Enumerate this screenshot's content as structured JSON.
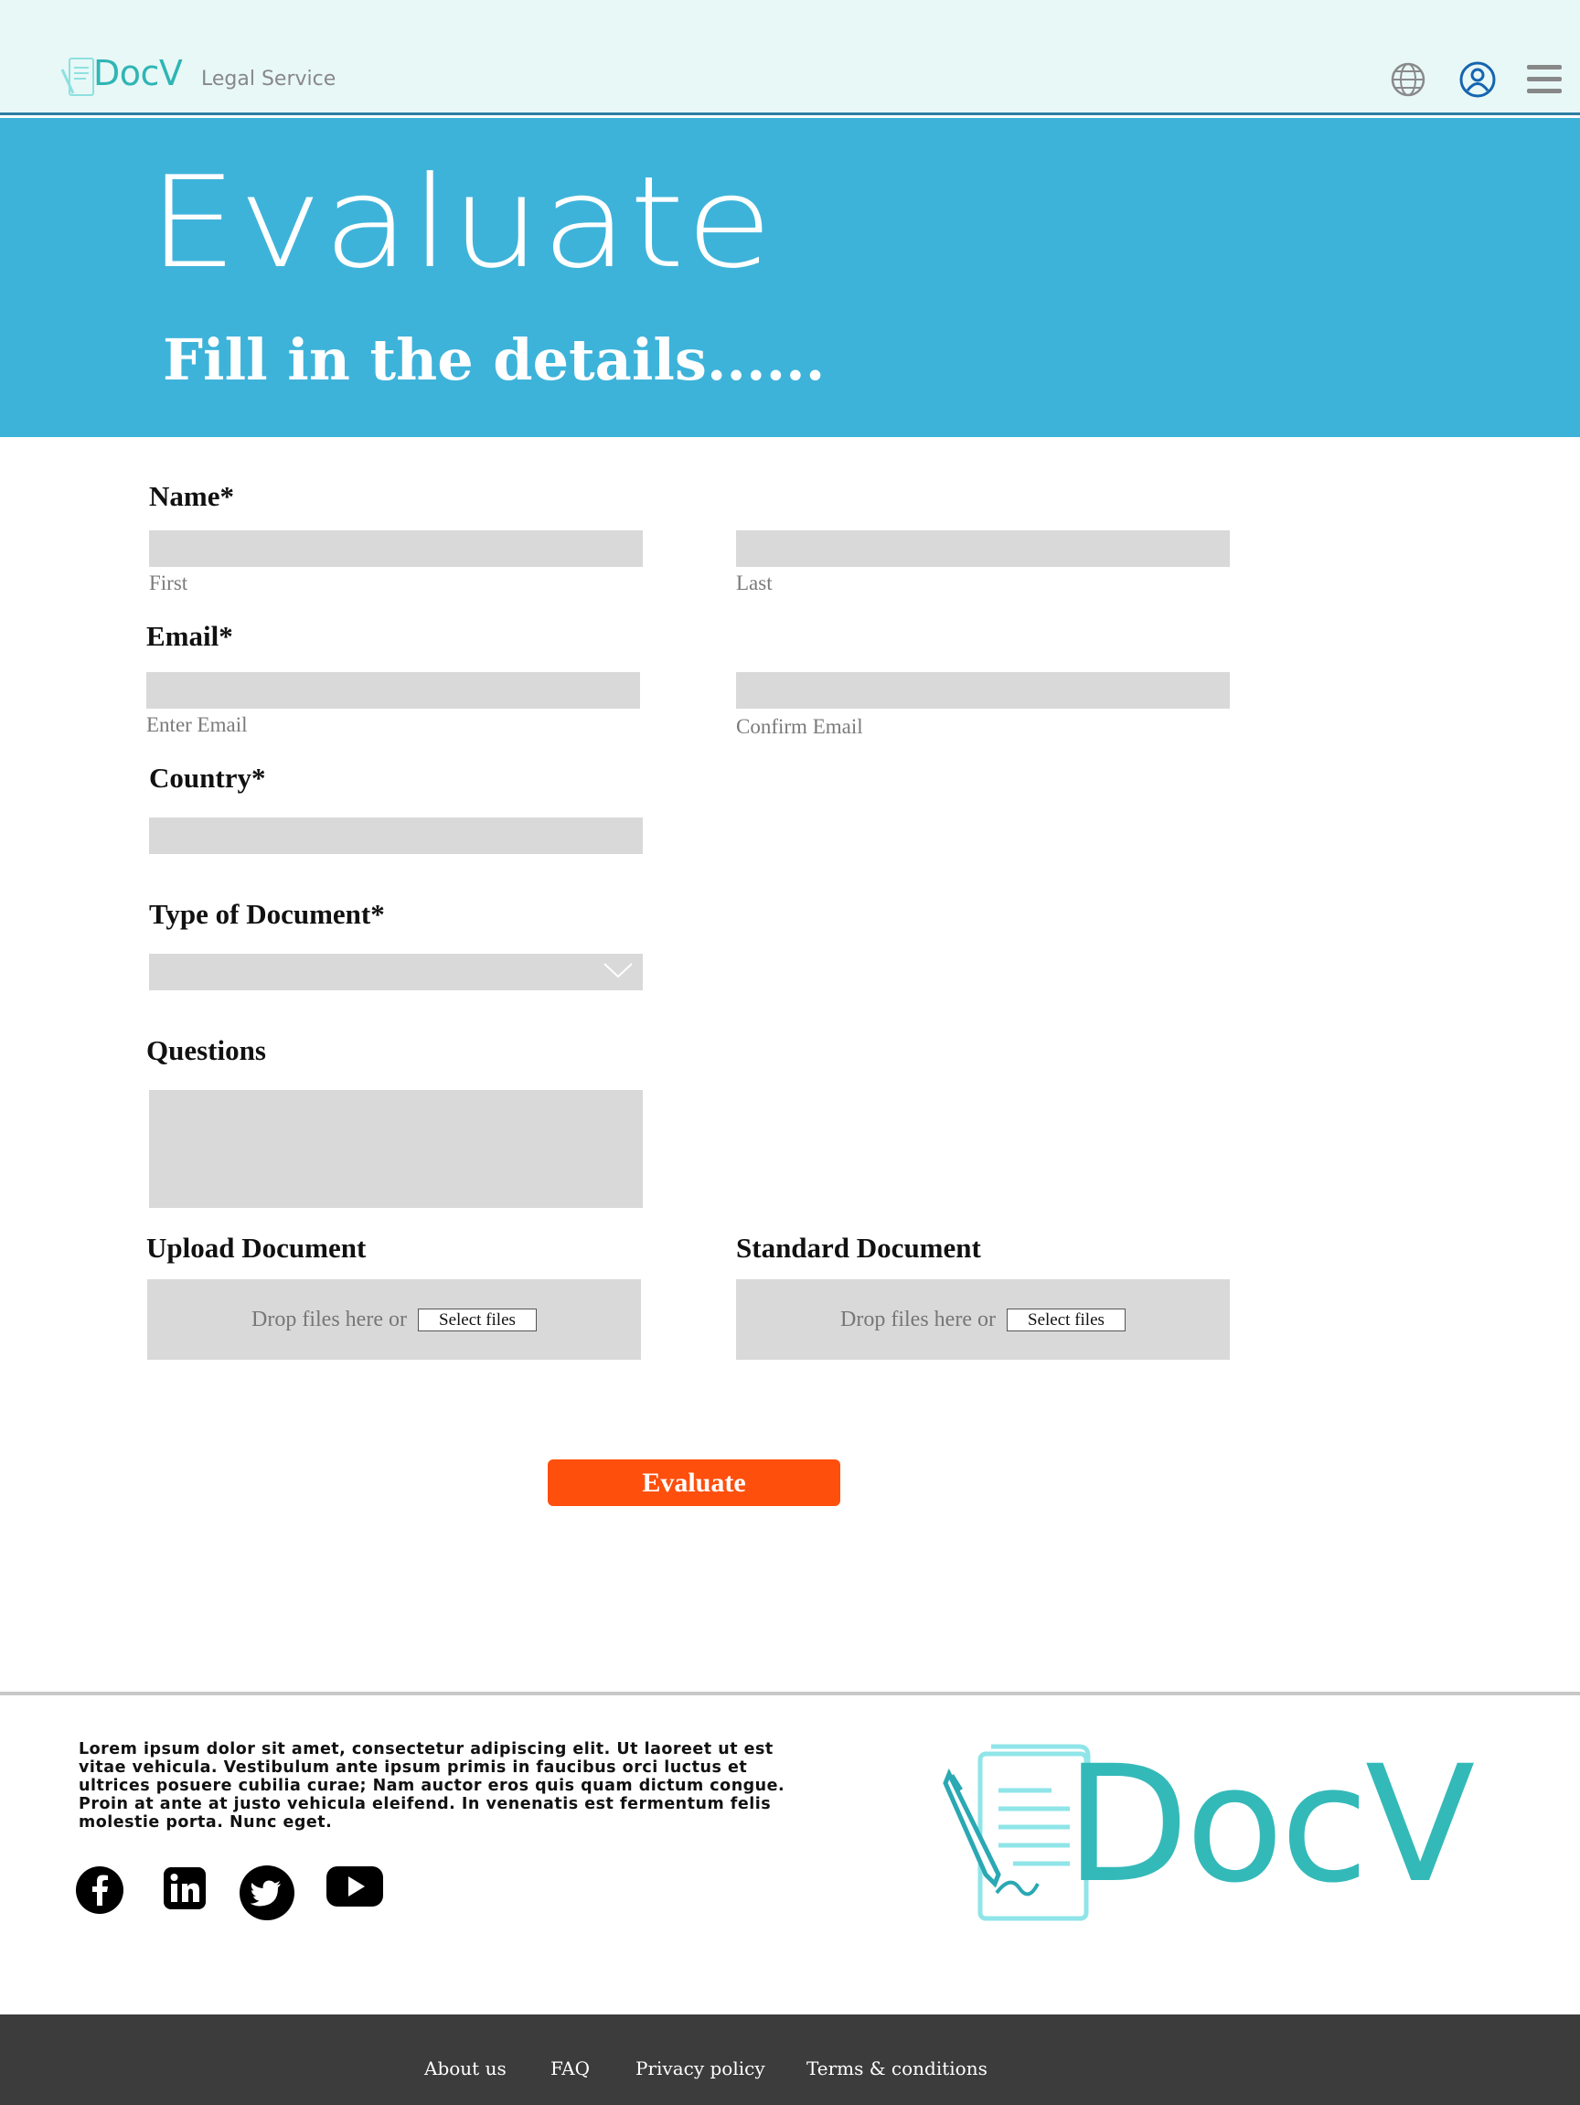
{
  "header": {
    "brand": "DocV",
    "tagline": "Legal Service",
    "icons": [
      "globe-icon",
      "account-icon",
      "menu-icon"
    ]
  },
  "hero": {
    "title": "Evaluate",
    "subtitle": "Fill in the details......"
  },
  "form": {
    "name_label": "Name*",
    "first_hint": "First",
    "last_hint": "Last",
    "email_label": "Email*",
    "email_hint": "Enter Email",
    "confirm_email_hint": "Confirm Email",
    "country_label": "Country*",
    "doc_type_label": "Type of Document*",
    "questions_label": "Questions",
    "upload_label": "Upload Document",
    "standard_label": "Standard Document",
    "drop_text": "Drop files here or",
    "select_files": "Select files",
    "submit_label": "Evaluate"
  },
  "footer": {
    "text": "Lorem ipsum dolor sit amet, consectetur adipiscing elit. Ut laoreet ut est vitae vehicula. Vestibulum ante ipsum primis in faucibus orci luctus et ultrices posuere cubilia curae; Nam auctor eros quis quam dictum congue. Proin at ante at justo vehicula eleifend. In venenatis est fermentum felis molestie porta. Nunc eget.",
    "brand": "DocV",
    "social": [
      "facebook-icon",
      "linkedin-icon",
      "twitter-icon",
      "youtube-icon"
    ],
    "links": [
      "About us",
      "FAQ",
      "Privacy policy",
      "Terms & conditions"
    ]
  },
  "colors": {
    "header_bg": "#e8f8f7",
    "hero_bg": "#3eb3da",
    "brand_teal": "#34b9b9",
    "field_bg": "#d9d9d9",
    "button_orange": "#fe4f0d",
    "bottom_bar": "#3c3c3c"
  }
}
